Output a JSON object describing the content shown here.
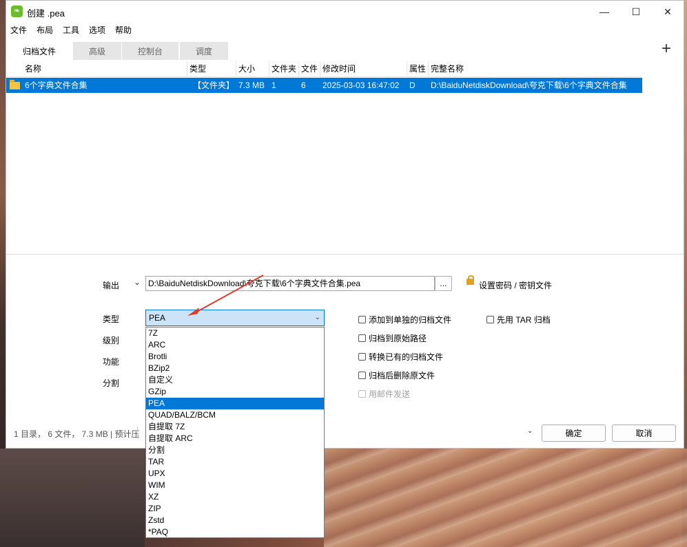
{
  "window": {
    "title": "创建 .pea",
    "controls": {
      "minimize": "—",
      "maximize": "☐",
      "close": "✕"
    }
  },
  "menu": [
    "文件",
    "布局",
    "工具",
    "选项",
    "帮助"
  ],
  "tabs": [
    {
      "label": "归档文件",
      "active": true
    },
    {
      "label": "高级",
      "active": false
    },
    {
      "label": "控制台",
      "active": false
    },
    {
      "label": "调度",
      "active": false
    }
  ],
  "add_symbol": "+",
  "table": {
    "columns": [
      "名称",
      "类型",
      "大小",
      "文件夹",
      "文件",
      "修改时间",
      "属性",
      "完整名称"
    ],
    "rows": [
      {
        "name": "6个字典文件合集",
        "type": "【文件夹】",
        "size": "7.3 MB",
        "folders": "1",
        "files": "6",
        "modified": "2025-03-03 16:47:02",
        "attr": "D",
        "fullname": "D:\\BaiduNetdiskDownload\\夸克下载\\6个字典文件合集"
      }
    ]
  },
  "output": {
    "label": "输出",
    "dropdown_glyph": "⌄",
    "path": "D:\\BaiduNetdiskDownload\\夸克下载\\6个字典文件合集.pea",
    "browse": "...",
    "password_link": "设置密码 / 密钥文件"
  },
  "labels": {
    "type": "类型",
    "level": "级别",
    "function": "功能",
    "split": "分割"
  },
  "type_select": {
    "value": "PEA",
    "options": [
      "7Z",
      "ARC",
      "Brotli",
      "BZip2",
      "自定义",
      "GZip",
      "PEA",
      "QUAD/BALZ/BCM",
      "自提取 7Z",
      "自提取 ARC",
      "分割",
      "TAR",
      "UPX",
      "WIM",
      "XZ",
      "ZIP",
      "Zstd",
      "*PAQ"
    ],
    "selected": "PEA"
  },
  "checkboxes": [
    {
      "label": "添加到单独的归档文件",
      "checked": false,
      "disabled": false
    },
    {
      "label": "归档到原始路径",
      "checked": false,
      "disabled": false
    },
    {
      "label": "转换已有的归档文件",
      "checked": false,
      "disabled": false
    },
    {
      "label": "归档后删除原文件",
      "checked": false,
      "disabled": false
    },
    {
      "label": "用邮件发送",
      "checked": false,
      "disabled": true
    },
    {
      "label": "先用 TAR 归档",
      "checked": false,
      "disabled": false
    }
  ],
  "status_text": "1 目录， 6 文件， 7.3 MB | 预计压",
  "buttons": {
    "ok": "确定",
    "cancel": "取消"
  },
  "colors": {
    "selection": "#0078d7",
    "arrow": "#e03a2a",
    "app_icon": "#6cbd2b"
  }
}
